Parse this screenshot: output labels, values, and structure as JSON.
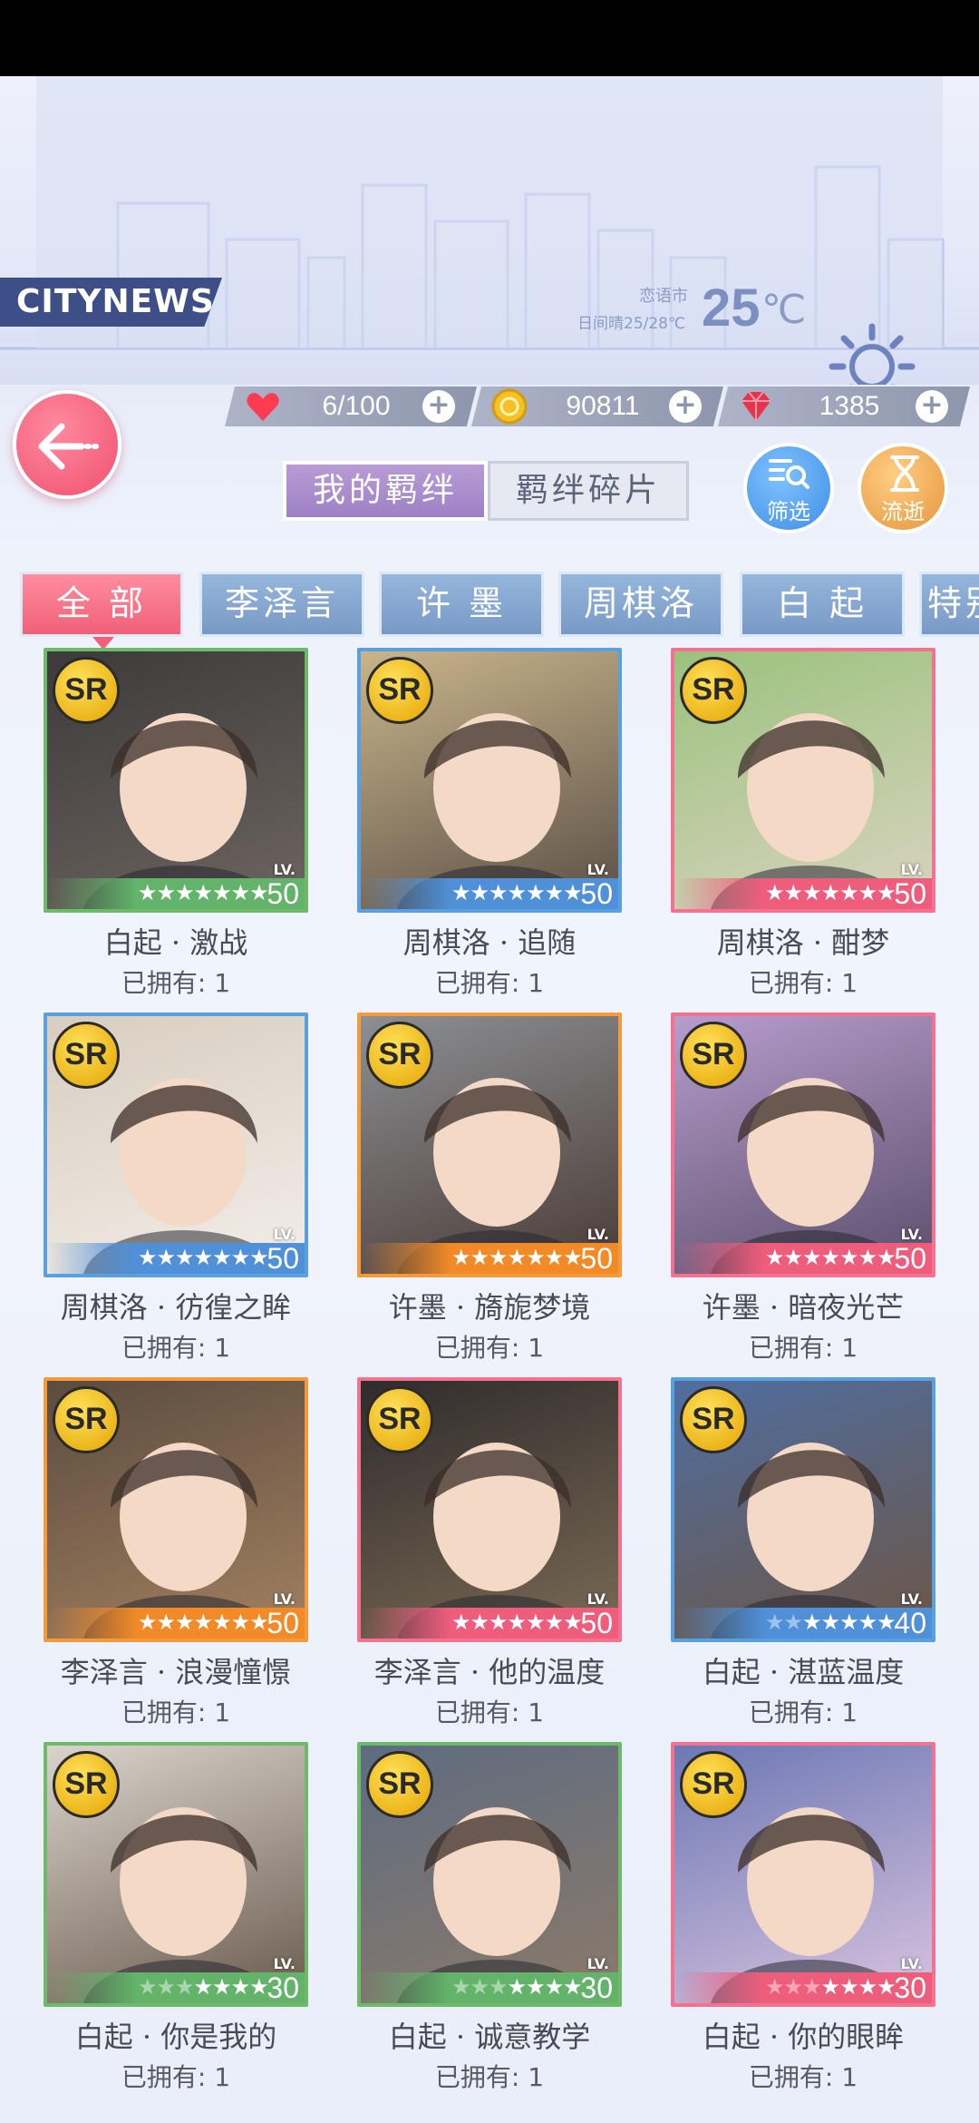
{
  "banner": {
    "brand": "CITYNEWS",
    "city": "恋语市",
    "range": "日间晴25/28℃",
    "temperature": "25",
    "unit": "℃"
  },
  "resources": {
    "hearts": "6/100",
    "coins": "90811",
    "gems": "1385"
  },
  "segments": {
    "active": "我的羁绊",
    "inactive": "羁绊碎片"
  },
  "buttons": {
    "filter": "筛选",
    "fade": "流逝"
  },
  "tabs": [
    "全 部",
    "李泽言",
    "许 墨",
    "周棋洛",
    "白 起",
    "特别"
  ],
  "cards": [
    {
      "name": "白起 · 激战",
      "owned": "已拥有: 1",
      "rarity": "SR",
      "level": "50",
      "stars": 7,
      "max_stars": 7,
      "frame": "#6fb96a",
      "strip": "#63b46a"
    },
    {
      "name": "周棋洛 · 追随",
      "owned": "已拥有: 1",
      "rarity": "SR",
      "level": "50",
      "stars": 7,
      "max_stars": 7,
      "frame": "#5aa0e0",
      "strip": "#4f90d8"
    },
    {
      "name": "周棋洛 · 酣梦",
      "owned": "已拥有: 1",
      "rarity": "SR",
      "level": "50",
      "stars": 7,
      "max_stars": 7,
      "frame": "#f37290",
      "strip": "#ef5d7d"
    },
    {
      "name": "周棋洛 · 彷徨之眸",
      "owned": "已拥有: 1",
      "rarity": "SR",
      "level": "50",
      "stars": 7,
      "max_stars": 7,
      "frame": "#5aa0e0",
      "strip": "#4f90d8"
    },
    {
      "name": "许墨 · 旖旎梦境",
      "owned": "已拥有: 1",
      "rarity": "SR",
      "level": "50",
      "stars": 7,
      "max_stars": 7,
      "frame": "#f59a3a",
      "strip": "#f28a28"
    },
    {
      "name": "许墨 · 暗夜光芒",
      "owned": "已拥有: 1",
      "rarity": "SR",
      "level": "50",
      "stars": 7,
      "max_stars": 7,
      "frame": "#f37290",
      "strip": "#ef5d7d"
    },
    {
      "name": "李泽言 · 浪漫憧憬",
      "owned": "已拥有: 1",
      "rarity": "SR",
      "level": "50",
      "stars": 7,
      "max_stars": 7,
      "frame": "#f59a3a",
      "strip": "#f28a28"
    },
    {
      "name": "李泽言 · 他的温度",
      "owned": "已拥有: 1",
      "rarity": "SR",
      "level": "50",
      "stars": 7,
      "max_stars": 7,
      "frame": "#f37290",
      "strip": "#ef5d7d"
    },
    {
      "name": "白起 · 湛蓝温度",
      "owned": "已拥有: 1",
      "rarity": "SR",
      "level": "40",
      "stars": 5,
      "max_stars": 7,
      "frame": "#5aa0e0",
      "strip": "#4f90d8"
    },
    {
      "name": "白起 · 你是我的",
      "owned": "已拥有: 1",
      "rarity": "SR",
      "level": "30",
      "stars": 4,
      "max_stars": 7,
      "frame": "#6fb96a",
      "strip": "#63b46a"
    },
    {
      "name": "白起 · 诚意教学",
      "owned": "已拥有: 1",
      "rarity": "SR",
      "level": "30",
      "stars": 4,
      "max_stars": 7,
      "frame": "#6fb96a",
      "strip": "#63b46a"
    },
    {
      "name": "白起 · 你的眼眸",
      "owned": "已拥有: 1",
      "rarity": "SR",
      "level": "30",
      "stars": 4,
      "max_stars": 7,
      "frame": "#f37290",
      "strip": "#ef5d7d"
    }
  ],
  "card_labels": {
    "lv": "LV."
  }
}
